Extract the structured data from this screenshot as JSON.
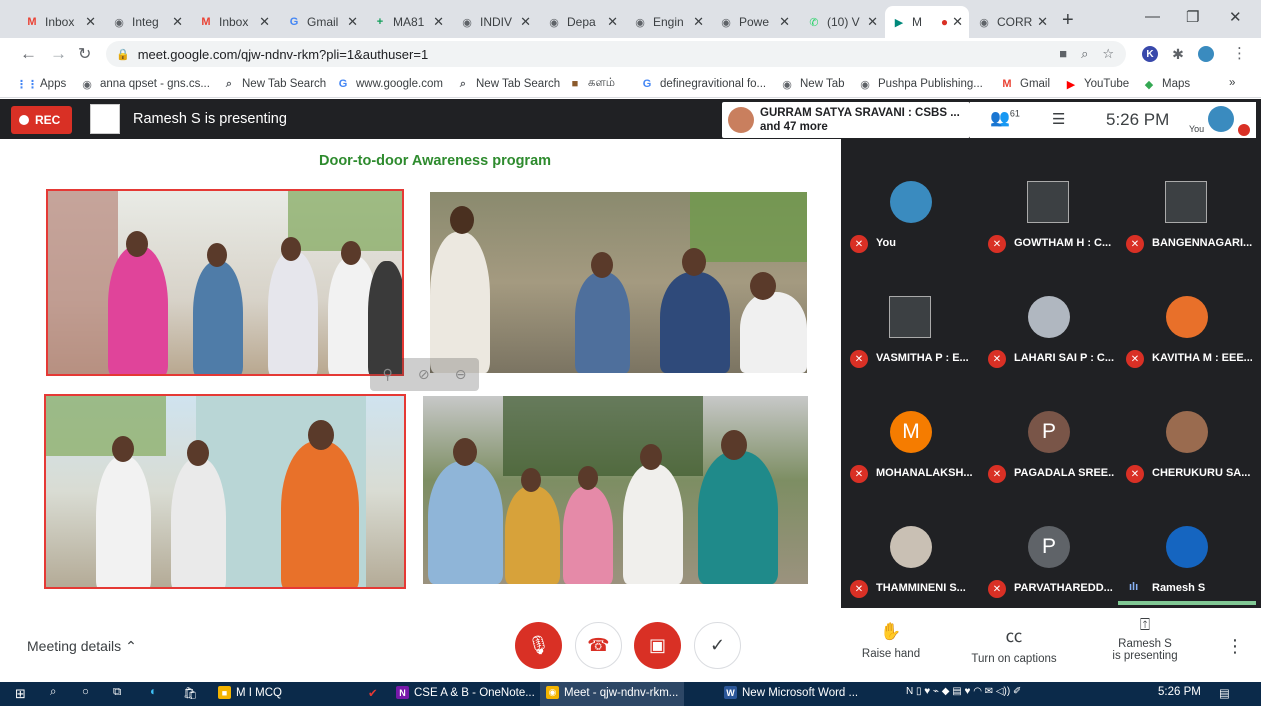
{
  "browser": {
    "tabs": [
      {
        "label": "Inbox",
        "icon": "gmail-icon",
        "icolor": "#ea4335",
        "glyph": "M"
      },
      {
        "label": "Integ",
        "icon": "web-icon",
        "icolor": "#5f6368",
        "glyph": "◉"
      },
      {
        "label": "Inbox",
        "icon": "gmail-icon",
        "icolor": "#ea4335",
        "glyph": "M"
      },
      {
        "label": "Gmail",
        "icon": "google-icon",
        "icolor": "#4285f4",
        "glyph": "G"
      },
      {
        "label": "MA81",
        "icon": "sheets-icon",
        "icolor": "#0f9d58",
        "glyph": "+"
      },
      {
        "label": "INDIV",
        "icon": "web-icon",
        "icolor": "#5f6368",
        "glyph": "◉"
      },
      {
        "label": "Depa",
        "icon": "web-icon",
        "icolor": "#5f6368",
        "glyph": "◉"
      },
      {
        "label": "Engin",
        "icon": "web-icon",
        "icolor": "#5f6368",
        "glyph": "◉"
      },
      {
        "label": "Powe",
        "icon": "web-icon",
        "icolor": "#5f6368",
        "glyph": "◉"
      },
      {
        "label": "(10) V",
        "icon": "whatsapp-icon",
        "icolor": "#25d366",
        "glyph": "✆"
      },
      {
        "label": "M",
        "icon": "meet-icon",
        "icolor": "#00897b",
        "glyph": "▶"
      },
      {
        "label": "CORR",
        "icon": "web-icon",
        "icolor": "#5f6368",
        "glyph": "◉"
      }
    ],
    "url": "meet.google.com/qjw-ndnv-rkm?pli=1&authuser=1",
    "bookmarks": [
      {
        "label": "Apps",
        "glyph": "⋮⋮",
        "color": "#4285f4"
      },
      {
        "label": "anna qpset - gns.cs...",
        "glyph": "◉",
        "color": "#5f6368"
      },
      {
        "label": "New Tab Search",
        "glyph": "⌕",
        "color": "#5f6368"
      },
      {
        "label": "www.google.com",
        "glyph": "G",
        "color": "#4285f4"
      },
      {
        "label": "New Tab Search",
        "glyph": "⌕",
        "color": "#5f6368"
      },
      {
        "label": "களம்",
        "glyph": "■",
        "color": "#8b5a2b"
      },
      {
        "label": "definegravitional fo...",
        "glyph": "G",
        "color": "#4285f4"
      },
      {
        "label": "New Tab",
        "glyph": "◉",
        "color": "#5f6368"
      },
      {
        "label": "Pushpa Publishing...",
        "glyph": "◉",
        "color": "#5f6368"
      },
      {
        "label": "Gmail",
        "glyph": "M",
        "color": "#ea4335"
      },
      {
        "label": "YouTube",
        "glyph": "▶",
        "color": "#ff0000"
      },
      {
        "label": "Maps",
        "glyph": "◆",
        "color": "#34a853"
      }
    ],
    "more_bookmarks": "»"
  },
  "meet": {
    "rec_label": "REC",
    "presenting_label": "Ramesh S is presenting",
    "participants_line1": "GURRAM SATYA SRAVANI : CSBS ...",
    "participants_line2": "and 47 more",
    "participant_count": "61",
    "time": "5:26 PM",
    "you_label": "You",
    "slide_title": "Door-to-door Awareness program",
    "tiles": [
      {
        "name": "You",
        "type": "photo",
        "color": "#3a8bbf"
      },
      {
        "name": "GOWTHAM H : C...",
        "type": "broken"
      },
      {
        "name": "BANGENNAGARI...",
        "type": "broken"
      },
      {
        "name": "VASMITHA P : E...",
        "type": "broken"
      },
      {
        "name": "LAHARI SAI P : C...",
        "type": "photo",
        "color": "#b0b7c0"
      },
      {
        "name": "KAVITHA M : EEE...",
        "type": "photo",
        "color": "#e8702a"
      },
      {
        "name": "MOHANALAKSH...",
        "type": "letter",
        "letter": "M",
        "color": "#f57c00"
      },
      {
        "name": "PAGADALA SREE...",
        "type": "letter",
        "letter": "P",
        "color": "#795548"
      },
      {
        "name": "CHERUKURU SA...",
        "type": "photo",
        "color": "#9a6b4f"
      },
      {
        "name": "THAMMINENI S...",
        "type": "photo",
        "color": "#c9c0b4"
      },
      {
        "name": "PARVATHAREDD...",
        "type": "letter",
        "letter": "P",
        "color": "#5f6368"
      },
      {
        "name": "Ramesh S",
        "type": "photo",
        "color": "#1565c0",
        "speaking": true
      }
    ],
    "controls": {
      "meeting_details": "Meeting details",
      "raise_hand": "Raise hand",
      "captions": "Turn on captions",
      "present_line1": "Ramesh S",
      "present_line2": "is presenting"
    }
  },
  "taskbar": {
    "items": [
      {
        "label": "M I MCQ",
        "glyph": "■",
        "color": "#f4b400"
      },
      {
        "label": "CSE A & B - OneNote...",
        "glyph": "N",
        "color": "#7719aa"
      },
      {
        "label": "Meet - qjw-ndnv-rkm...",
        "glyph": "◉",
        "color": "#f4b400"
      },
      {
        "label": "New Microsoft Word ...",
        "glyph": "W",
        "color": "#2b579a"
      }
    ],
    "clock": "5:26 PM"
  }
}
